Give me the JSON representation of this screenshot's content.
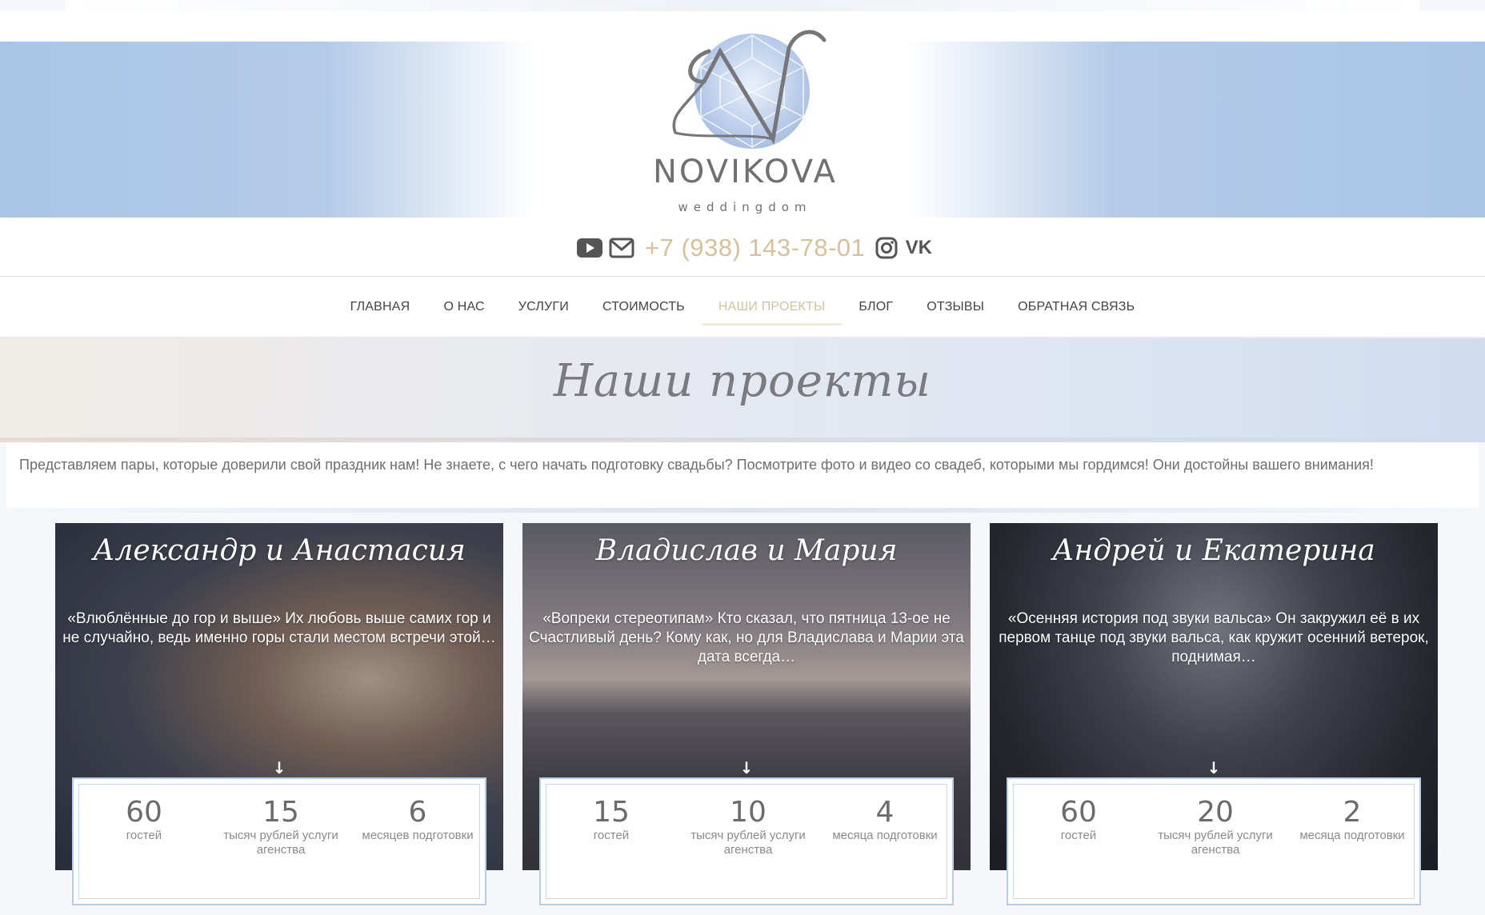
{
  "brand": {
    "name": "NOVIKOVA",
    "tagline": "weddingdom"
  },
  "contacts": {
    "phone": "+7 (938) 143-78-01",
    "vk_label": "VK",
    "icons": [
      "youtube-icon",
      "mail-icon",
      "instagram-icon",
      "vk-icon"
    ]
  },
  "nav": {
    "items": [
      {
        "label": "ГЛАВНАЯ"
      },
      {
        "label": "О НАС"
      },
      {
        "label": "УСЛУГИ"
      },
      {
        "label": "СТОИМОСТЬ"
      },
      {
        "label": "НАШИ ПРОЕКТЫ",
        "active": true
      },
      {
        "label": "БЛОГ"
      },
      {
        "label": "ОТЗЫВЫ"
      },
      {
        "label": "ОБРАТНАЯ СВЯЗЬ"
      }
    ]
  },
  "page": {
    "title": "Наши проекты",
    "intro": "Представляем пары, которые доверили свой праздник нам! Не знаете, с чего начать подготовку свадьбы? Посмотрите фото и видео со свадеб, которыми мы гордимся! Они достойны вашего внимания!"
  },
  "projects": [
    {
      "couple": "Александр и Анастасия",
      "excerpt": "«Влюблённые до гор и выше»  Их любовь выше самих гор и не случайно, ведь именно горы стали местом встречи этой…",
      "stats": [
        {
          "value": "60",
          "label": "гостей"
        },
        {
          "value": "15",
          "label": "тысяч рублей услуги агенства"
        },
        {
          "value": "6",
          "label": "месяцев подготовки"
        }
      ]
    },
    {
      "couple": "Владислав и Мария",
      "excerpt": "«Вопреки стереотипам» Кто сказал, что пятница 13-ое не Счастливый день? Кому как, но для Владислава и Марии эта дата всегда…",
      "stats": [
        {
          "value": "15",
          "label": "гостей"
        },
        {
          "value": "10",
          "label": "тысяч рублей услуги агенства"
        },
        {
          "value": "4",
          "label": "месяца подготовки"
        }
      ]
    },
    {
      "couple": "Андрей и Екатерина",
      "excerpt": "«Осенняя история под звуки вальса»  Он закружил её в их первом танце под звуки вальса, как кружит осенний ветерок, поднимая…",
      "stats": [
        {
          "value": "60",
          "label": "гостей"
        },
        {
          "value": "20",
          "label": "тысяч рублей услуги агенства"
        },
        {
          "value": "2",
          "label": "месяца подготовки"
        }
      ]
    }
  ],
  "colors": {
    "accent": "#d8c19a",
    "header_blue": "#a9c5e6",
    "text": "#555555",
    "card_border": "#b7cde6"
  }
}
